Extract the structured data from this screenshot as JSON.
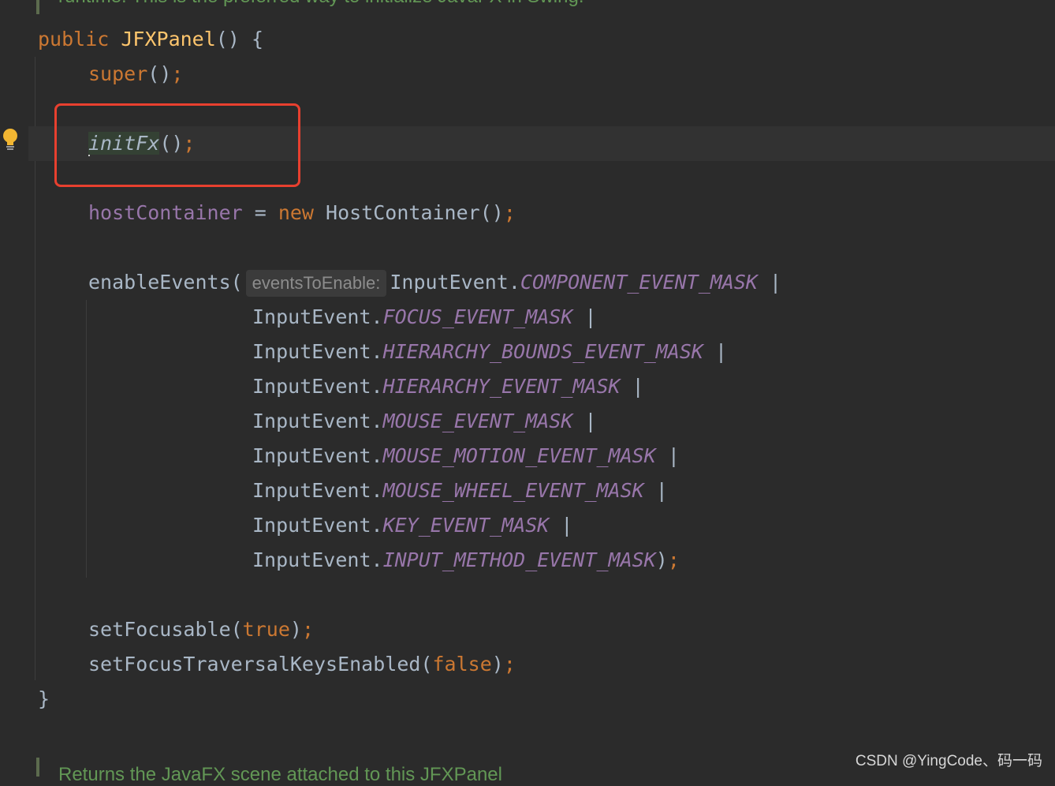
{
  "editor": {
    "doc_top": "runtime. This is the preferred way to initialize JavaFX in Swing.",
    "doc_bottom": "Returns the JavaFX scene attached to this JFXPanel",
    "code": {
      "l1_kw": "public",
      "l1_name": "JFXPanel",
      "l1_rest": "() {",
      "l2_kw": "super",
      "l2_rest": "()",
      "l2_semi": ";",
      "l3_call": "initFx",
      "l3_rest": "()",
      "l3_semi": ";",
      "l4_field": "hostContainer",
      "l4_eq": " = ",
      "l4_kw": "new",
      "l4_rest": " HostContainer()",
      "l4_semi": ";",
      "l5_call": "enableEvents(",
      "l5_hint": "eventsToEnable:",
      "cls": "InputEvent.",
      "masks": [
        {
          "name": "COMPONENT_EVENT_MASK",
          "tail": " |"
        },
        {
          "name": "FOCUS_EVENT_MASK",
          "tail": " |"
        },
        {
          "name": "HIERARCHY_BOUNDS_EVENT_MASK",
          "tail": " |"
        },
        {
          "name": "HIERARCHY_EVENT_MASK",
          "tail": " |"
        },
        {
          "name": "MOUSE_EVENT_MASK",
          "tail": " |"
        },
        {
          "name": "MOUSE_MOTION_EVENT_MASK",
          "tail": " |"
        },
        {
          "name": "MOUSE_WHEEL_EVENT_MASK",
          "tail": " |"
        },
        {
          "name": "KEY_EVENT_MASK",
          "tail": " |"
        },
        {
          "name": "INPUT_METHOD_EVENT_MASK",
          "tail": ")"
        }
      ],
      "l_final_semi": ";",
      "l6_call": "setFocusable(",
      "l6_kw": "true",
      "l6_rest": ")",
      "l6_semi": ";",
      "l7_call": "setFocusTraversalKeysEnabled(",
      "l7_kw": "false",
      "l7_rest": ")",
      "l7_semi": ";",
      "l8": "}"
    }
  },
  "gutter": {
    "intention_icon": "lightbulb-icon"
  },
  "annotation": {
    "box_color": "#e8402f"
  },
  "watermark": "CSDN @YingCode、码一码",
  "colors": {
    "background": "#2b2b2b",
    "keyword": "#cc7832",
    "method_decl": "#ffc66d",
    "field": "#9876aa",
    "text": "#a9b7c6",
    "doc_comment": "#629755"
  }
}
